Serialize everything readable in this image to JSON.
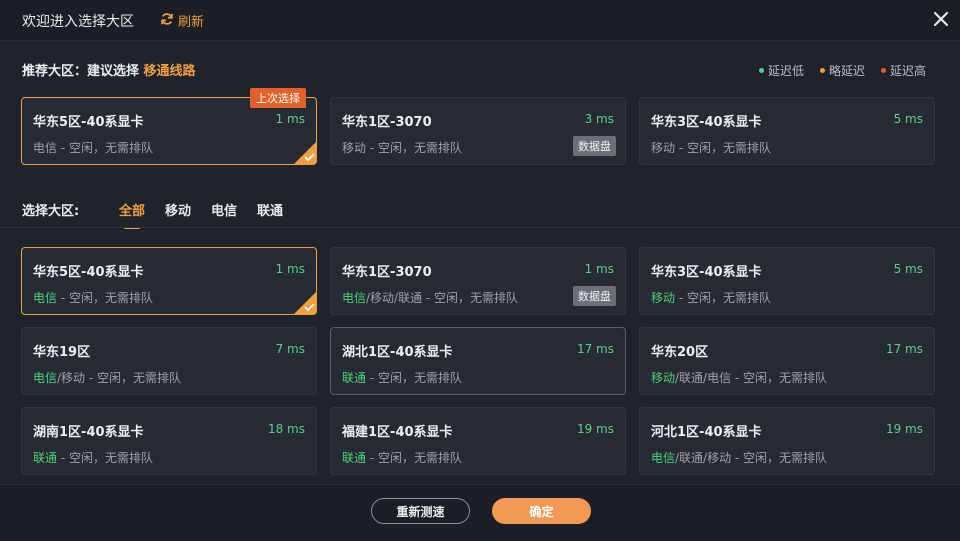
{
  "header": {
    "title": "欢迎进入选择大区",
    "refresh_label": "刷新"
  },
  "recommend": {
    "label": "推荐大区：建议选择",
    "highlight": "移通线路",
    "legend": [
      {
        "label": "延迟低",
        "color": "#5fce8a"
      },
      {
        "label": "略延迟",
        "color": "#f0a040"
      },
      {
        "label": "延迟高",
        "color": "#e2612a"
      }
    ],
    "cards": [
      {
        "name": "华东5区-40系显卡",
        "latency": "1 ms",
        "isp": "",
        "status": "电信 - 空闲，无需排队",
        "tag": "上次选择",
        "badge": ""
      },
      {
        "name": "华东1区-3070",
        "latency": "3 ms",
        "isp": "",
        "status": "移动 - 空闲，无需排队",
        "tag": "",
        "badge": "数据盘"
      },
      {
        "name": "华东3区-40系显卡",
        "latency": "5 ms",
        "isp": "",
        "status": "移动 - 空闲，无需排队",
        "tag": "",
        "badge": ""
      }
    ]
  },
  "select": {
    "label": "选择大区:",
    "tabs": [
      "全部",
      "移动",
      "电信",
      "联通"
    ],
    "cards": [
      {
        "name": "华东5区-40系显卡",
        "latency": "1 ms",
        "isp": "电信",
        "status": " - 空闲，无需排队",
        "badge": ""
      },
      {
        "name": "华东1区-3070",
        "latency": "1 ms",
        "isp": "电信",
        "status": "/移动/联通 - 空闲，无需排队",
        "badge": "数据盘"
      },
      {
        "name": "华东3区-40系显卡",
        "latency": "5 ms",
        "isp": "移动",
        "status": " - 空闲，无需排队",
        "badge": ""
      },
      {
        "name": "华东19区",
        "latency": "7 ms",
        "isp": "电信",
        "status": "/移动 - 空闲，无需排队",
        "badge": ""
      },
      {
        "name": "湖北1区-40系显卡",
        "latency": "17 ms",
        "isp": "联通",
        "status": " - 空闲，无需排队",
        "badge": ""
      },
      {
        "name": "华东20区",
        "latency": "17 ms",
        "isp": "移动",
        "status": "/联通/电信 - 空闲，无需排队",
        "badge": ""
      },
      {
        "name": "湖南1区-40系显卡",
        "latency": "18 ms",
        "isp": "联通",
        "status": " - 空闲，无需排队",
        "badge": ""
      },
      {
        "name": "福建1区-40系显卡",
        "latency": "19 ms",
        "isp": "联通",
        "status": " - 空闲，无需排队",
        "badge": ""
      },
      {
        "name": "河北1区-40系显卡",
        "latency": "19 ms",
        "isp": "电信",
        "status": "/联通/移动 - 空闲，无需排队",
        "badge": ""
      }
    ]
  },
  "footer": {
    "retest_label": "重新测速",
    "confirm_label": "确定"
  }
}
